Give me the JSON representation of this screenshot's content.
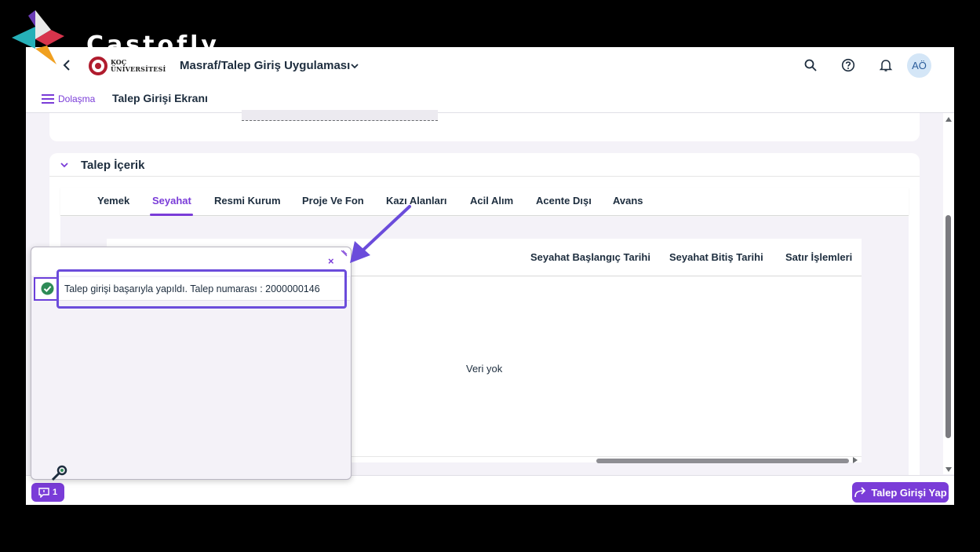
{
  "watermark": {
    "text": "Castofly"
  },
  "shellbar": {
    "logo_line1": "KOÇ",
    "logo_line2": "ÜNİVERSİTESİ",
    "app_title": "Masraf/Talep Giriş Uygulaması",
    "avatar_initials": "AÖ",
    "icons": [
      "back-icon",
      "chevron-down-icon",
      "search-icon",
      "help-icon",
      "bell-icon"
    ]
  },
  "subbar": {
    "nav_label": "Dolaşma",
    "page_title": "Talep Girişi Ekranı"
  },
  "section": {
    "title": "Talep İçerik",
    "tabs": [
      {
        "label": "Yemek",
        "active": false
      },
      {
        "label": "Seyahat",
        "active": true
      },
      {
        "label": "Resmi Kurum",
        "active": false
      },
      {
        "label": "Proje Ve Fon",
        "active": false
      },
      {
        "label": "Kazı Alanları",
        "active": false
      },
      {
        "label": "Acil Alım",
        "active": false
      },
      {
        "label": "Acente Dışı",
        "active": false
      },
      {
        "label": "Avans",
        "active": false
      }
    ],
    "table": {
      "columns": [
        "Seyahat Başlangıç Tarihi",
        "Seyahat Bitiş Tarihi",
        "Satır İşlemleri"
      ],
      "empty_text": "Veri yok"
    }
  },
  "popover": {
    "close_label": "×",
    "messages": [
      {
        "type": "success",
        "text": "Talep girişi başarıyla yapıldı. Talep numarası : 2000000146"
      }
    ]
  },
  "footer": {
    "message_count": "1",
    "submit_label": "Talep Girişi Yap"
  },
  "colors": {
    "accent": "#7a3cd8",
    "annotation": "#6b4cdb",
    "success": "#2e8b57"
  }
}
